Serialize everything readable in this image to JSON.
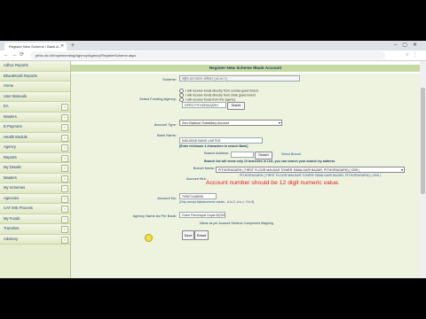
{
  "browser": {
    "tab_title": "Register New Scheme / Bank A...",
    "url": "pfms.nic.in/Implementing/Agency/Agency/RegisterScheme.aspx"
  },
  "sidebar": {
    "items": [
      {
        "label": "Adhoc Reports",
        "chevron": false
      },
      {
        "label": "BharatKosh Reports",
        "chevron": false
      },
      {
        "label": "Home",
        "chevron": false
      },
      {
        "label": "User Manuals",
        "chevron": false
      },
      {
        "label": "EA",
        "chevron": true
      },
      {
        "label": "Masters",
        "chevron": true
      },
      {
        "label": "E-Payment",
        "chevron": true
      },
      {
        "label": "Health Module",
        "chevron": true
      },
      {
        "label": "Agency",
        "chevron": true
      },
      {
        "label": "Reports",
        "chevron": true
      },
      {
        "label": "My Details",
        "chevron": true
      },
      {
        "label": "Masters",
        "chevron": true
      },
      {
        "label": "My Schemes",
        "chevron": true
      },
      {
        "label": "Agencies",
        "chevron": true
      },
      {
        "label": "CAT MIS Process",
        "chevron": true
      },
      {
        "label": "My Funds",
        "chevron": true
      },
      {
        "label": "Transfers",
        "chevron": true
      },
      {
        "label": "Advisory",
        "chevron": true
      }
    ]
  },
  "form": {
    "title": "Register New Scheme /Bank Account",
    "scheme_label": "Scheme:",
    "scheme_value": "राष्ट्रीय ग्राम स्वराज अभियान (28-HCT)",
    "funding_label": "Select Funding Agency:",
    "funding_options": [
      "I will receive funds directly from central government",
      "I will receive funds directly from state government",
      "I will receive funds from the agency"
    ],
    "funding_agency_value": "DPRO PITHORAGARH",
    "funding_btn": "Search",
    "account_type_label": "Account Type:",
    "account_type_value": "Zero Balance Subsidiary Account",
    "bank_name_label": "Bank Name:",
    "bank_name_value": "INDUSIND BANK LIMITED",
    "bank_hint": "[Enter minimum 4 characters to search Bank]",
    "branch_addr_label": "Branch Address:",
    "branch_search_btn": "Search",
    "select_branch": "Select Branch",
    "branch_note": "Branch list will show only 10 branches in List, you can search your branch by address",
    "branch_name_label": "Branch Name:",
    "branch_name_value": "PITHORAGARH ( FIRST FLOOR MALDAR TOWER SIMALGARI BAZAR, PITHORAGARH) ( CBS )",
    "branch_detail": "PITHORAGARH ( FIRST FLOOR MALDAR TOWER SIMALGARI BAZAR, PITHORAGARH) ( CBS )",
    "account_hint_label": "Account Hint:",
    "error_text": "Account number should be 12 digit numeric value.",
    "account_no_label": "Account No:",
    "account_no_value": "709571448096",
    "account_no_hint": "[Only accept Alphanumeric values - A to Z, a to z, 0 to 9]",
    "agency_name_label": "Agency Name As Per Bank:",
    "agency_name_value": "Gram Panchayat Goyal M(GM)",
    "agency_hint": "Name as per Account Scheme Component Mapping",
    "save_btn": "Save",
    "reset_btn": "Reset"
  }
}
